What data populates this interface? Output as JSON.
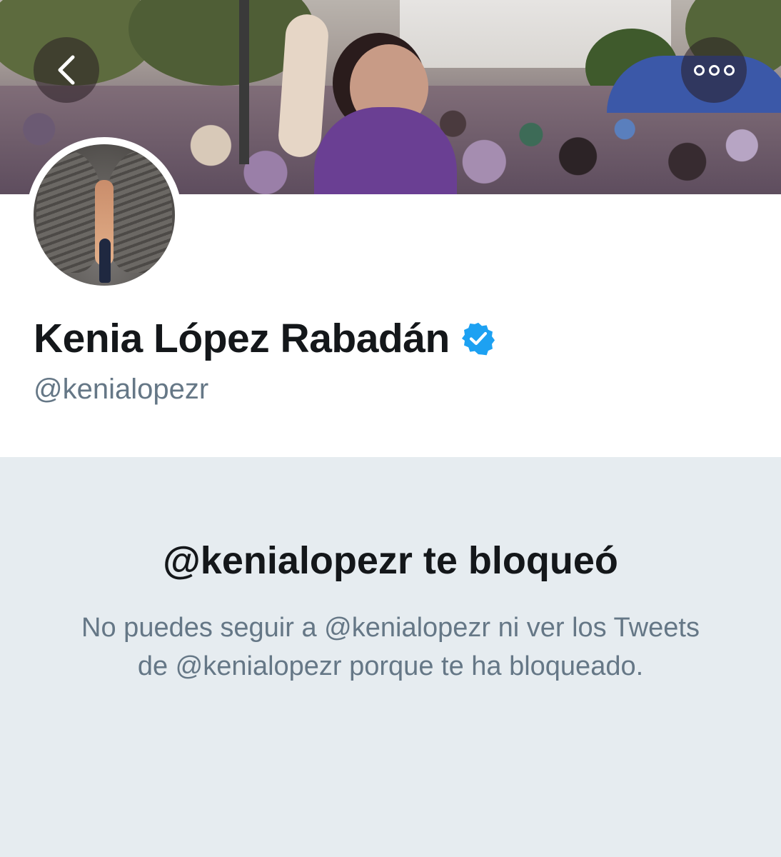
{
  "header": {
    "back_icon": "chevron-left-icon",
    "more_icon": "more-horizontal-icon"
  },
  "profile": {
    "display_name": "Kenia López Rabadán",
    "verified_icon": "verified-badge-icon",
    "handle": "@kenialopezr",
    "accent_color": "#1da1f2"
  },
  "blocked": {
    "title": "@kenialopezr te bloqueó",
    "description": "No puedes seguir a @kenialopezr ni ver los Tweets de @kenialopezr porque te ha bloqueado."
  },
  "colors": {
    "panel_background": "#e6ecf0",
    "secondary_text": "#657786",
    "primary_text": "#14171a"
  }
}
